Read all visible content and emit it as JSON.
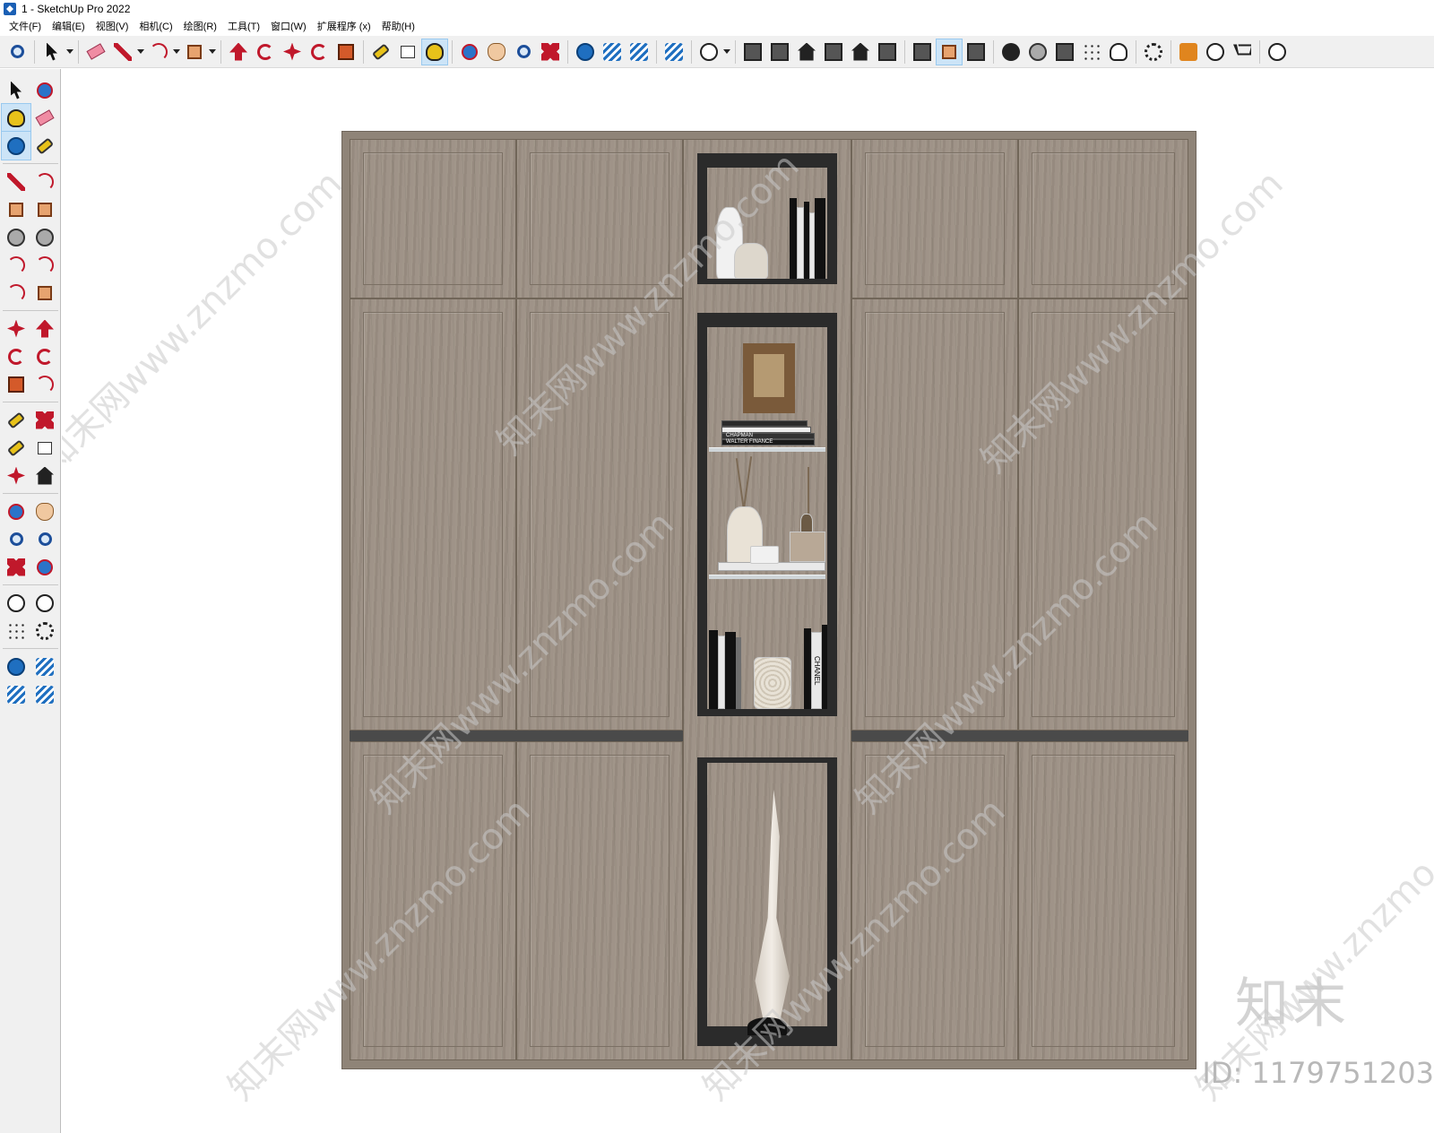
{
  "window": {
    "title": "1 - SketchUp Pro 2022"
  },
  "menu": [
    "文件(F)",
    "编辑(E)",
    "视图(V)",
    "相机(C)",
    "绘图(R)",
    "工具(T)",
    "窗口(W)",
    "扩展程序 (x)",
    "帮助(H)"
  ],
  "top_toolbar": [
    {
      "name": "zoom-icon",
      "glyph": "g-mag"
    },
    {
      "sep": true
    },
    {
      "name": "select-icon",
      "glyph": "g-arrow",
      "drop": true
    },
    {
      "sep": true
    },
    {
      "name": "eraser-icon",
      "glyph": "g-eraser"
    },
    {
      "name": "line-icon",
      "glyph": "g-pencil",
      "drop": true
    },
    {
      "name": "arc-icon",
      "glyph": "g-arc",
      "drop": true
    },
    {
      "name": "rectangle-icon",
      "glyph": "g-rect",
      "drop": true
    },
    {
      "sep": true
    },
    {
      "name": "push-pull-icon",
      "glyph": "g-push"
    },
    {
      "name": "follow-me-icon",
      "glyph": "g-rot"
    },
    {
      "name": "move-icon",
      "glyph": "g-move"
    },
    {
      "name": "rotate-icon",
      "glyph": "g-rot"
    },
    {
      "name": "scale-icon",
      "glyph": "g-scale"
    },
    {
      "sep": true
    },
    {
      "name": "tape-measure-icon",
      "glyph": "g-tape"
    },
    {
      "name": "text-icon",
      "glyph": "g-text"
    },
    {
      "name": "paint-bucket-icon",
      "glyph": "g-paint",
      "active": true
    },
    {
      "sep": true
    },
    {
      "name": "orbit-icon",
      "glyph": "g-orbit"
    },
    {
      "name": "pan-icon",
      "glyph": "g-hand"
    },
    {
      "name": "zoom-tool-icon",
      "glyph": "g-mag"
    },
    {
      "name": "zoom-extents-icon",
      "glyph": "g-zoomext"
    },
    {
      "sep": true
    },
    {
      "name": "3d-warehouse-icon",
      "glyph": "g-warehouse"
    },
    {
      "name": "extension-warehouse-icon",
      "glyph": "g-ext"
    },
    {
      "name": "share-model-icon",
      "glyph": "g-ext"
    },
    {
      "sep": true
    },
    {
      "name": "extension-manager-icon",
      "glyph": "g-ext"
    },
    {
      "sep": true
    },
    {
      "name": "account-icon",
      "glyph": "g-user",
      "drop": true
    },
    {
      "sep": true
    },
    {
      "name": "iso-view-icon",
      "glyph": "g-box"
    },
    {
      "name": "top-view-icon",
      "glyph": "g-box"
    },
    {
      "name": "front-view-icon",
      "glyph": "g-house"
    },
    {
      "name": "right-view-icon",
      "glyph": "g-box"
    },
    {
      "name": "back-view-icon",
      "glyph": "g-house"
    },
    {
      "name": "left-view-icon",
      "glyph": "g-box"
    },
    {
      "sep": true
    },
    {
      "name": "section-plane-icon",
      "glyph": "g-box"
    },
    {
      "name": "display-section-icon",
      "glyph": "g-rect",
      "active": true
    },
    {
      "name": "section-cuts-icon",
      "glyph": "g-box"
    },
    {
      "sep": true
    },
    {
      "name": "add-location-icon",
      "glyph": "g-plus"
    },
    {
      "name": "toggle-terrain-icon",
      "glyph": "g-circle-red"
    },
    {
      "name": "photo-textures-icon",
      "glyph": "g-box"
    },
    {
      "name": "match-photo-icon",
      "glyph": "g-dots"
    },
    {
      "name": "cloud-upload-icon",
      "glyph": "g-cloud"
    },
    {
      "sep": true
    },
    {
      "name": "settings-icon",
      "glyph": "g-gear"
    },
    {
      "sep": true
    },
    {
      "name": "feedback-icon",
      "glyph": "g-chat"
    },
    {
      "name": "info-icon",
      "glyph": "g-info"
    },
    {
      "name": "store-cart-icon",
      "glyph": "g-cart"
    },
    {
      "sep": true
    },
    {
      "name": "profile-icon",
      "glyph": "g-user"
    }
  ],
  "left_toolbar": [
    {
      "name": "select-icon",
      "glyph": "g-arrow"
    },
    {
      "name": "orbit-icon",
      "glyph": "g-orbit"
    },
    {
      "name": "paint-bucket-icon",
      "glyph": "g-paint",
      "active": true
    },
    {
      "name": "eraser-icon",
      "glyph": "g-eraser"
    },
    {
      "name": "make-component-icon",
      "glyph": "g-warehouse",
      "active": true
    },
    {
      "name": "tag-icon",
      "glyph": "g-tape"
    },
    {
      "sep": true
    },
    {
      "name": "line-icon",
      "glyph": "g-pencil"
    },
    {
      "name": "freehand-icon",
      "glyph": "g-arc"
    },
    {
      "name": "rectangle-icon",
      "glyph": "g-rect"
    },
    {
      "name": "rotated-rectangle-icon",
      "glyph": "g-rect"
    },
    {
      "name": "circle-icon",
      "glyph": "g-circle-red"
    },
    {
      "name": "polygon-icon",
      "glyph": "g-circle-red"
    },
    {
      "name": "arc-icon",
      "glyph": "g-arc"
    },
    {
      "name": "two-point-arc-icon",
      "glyph": "g-arc"
    },
    {
      "name": "three-point-arc-icon",
      "glyph": "g-arc"
    },
    {
      "name": "pie-icon",
      "glyph": "g-rect"
    },
    {
      "sep": true
    },
    {
      "name": "move-icon",
      "glyph": "g-move"
    },
    {
      "name": "push-pull-icon",
      "glyph": "g-push"
    },
    {
      "name": "rotate-icon",
      "glyph": "g-rot"
    },
    {
      "name": "follow-me-icon",
      "glyph": "g-rot"
    },
    {
      "name": "scale-icon",
      "glyph": "g-scale"
    },
    {
      "name": "offset-icon",
      "glyph": "g-arc"
    },
    {
      "sep": true
    },
    {
      "name": "tape-measure-icon",
      "glyph": "g-tape"
    },
    {
      "name": "dimension-icon",
      "glyph": "g-zoomext"
    },
    {
      "name": "protractor-icon",
      "glyph": "g-tape"
    },
    {
      "name": "text-icon",
      "glyph": "g-text"
    },
    {
      "name": "axes-icon",
      "glyph": "g-move"
    },
    {
      "name": "3d-text-icon",
      "glyph": "g-house"
    },
    {
      "sep": true
    },
    {
      "name": "orbit-icon",
      "glyph": "g-orbit"
    },
    {
      "name": "pan-icon",
      "glyph": "g-hand"
    },
    {
      "name": "zoom-icon",
      "glyph": "g-mag"
    },
    {
      "name": "zoom-window-icon",
      "glyph": "g-mag"
    },
    {
      "name": "zoom-extents-icon",
      "glyph": "g-zoomext"
    },
    {
      "name": "previous-view-icon",
      "glyph": "g-orbit"
    },
    {
      "sep": true
    },
    {
      "name": "position-camera-icon",
      "glyph": "g-user"
    },
    {
      "name": "look-around-icon",
      "glyph": "g-info"
    },
    {
      "name": "walk-icon",
      "glyph": "g-dots"
    },
    {
      "name": "section-plane-icon",
      "glyph": "g-gear"
    },
    {
      "sep": true
    },
    {
      "name": "3d-warehouse-icon",
      "glyph": "g-warehouse"
    },
    {
      "name": "extension-warehouse-icon",
      "glyph": "g-ext"
    },
    {
      "name": "share-model-icon",
      "glyph": "g-ext"
    },
    {
      "name": "extension-manager-icon",
      "glyph": "g-ext"
    }
  ],
  "model": {
    "book_spine_texts": [
      "WALTER",
      "FINANCE",
      "CHAPMAN",
      "CHANEL"
    ]
  },
  "watermark": {
    "text": "知末网www.znzmo.com",
    "brand": "知末",
    "id": "ID: 1179751203"
  },
  "colors": {
    "wood": "#9c9084",
    "niche": "#2b2b2b",
    "band": "#4a4a4a",
    "active_tool": "#cce4f7"
  }
}
